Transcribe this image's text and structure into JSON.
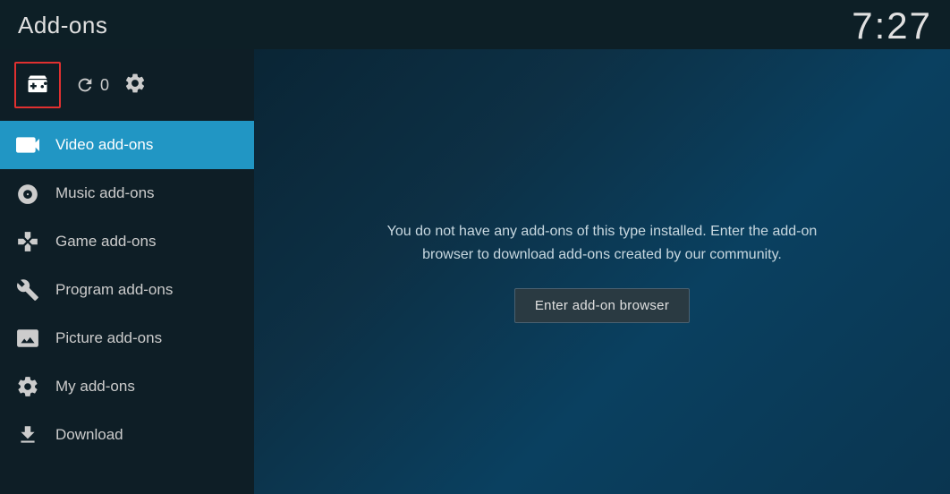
{
  "header": {
    "title": "Add-ons",
    "time": "7:27"
  },
  "toolbar": {
    "update_count": "0",
    "addon_box_icon": "addon-box-icon",
    "refresh_icon": "refresh-icon",
    "settings_icon": "gear-icon"
  },
  "sidebar": {
    "items": [
      {
        "id": "video",
        "label": "Video add-ons",
        "icon": "video-icon",
        "active": true
      },
      {
        "id": "music",
        "label": "Music add-ons",
        "icon": "music-icon",
        "active": false
      },
      {
        "id": "game",
        "label": "Game add-ons",
        "icon": "game-icon",
        "active": false
      },
      {
        "id": "program",
        "label": "Program add-ons",
        "icon": "program-icon",
        "active": false
      },
      {
        "id": "picture",
        "label": "Picture add-ons",
        "icon": "picture-icon",
        "active": false
      },
      {
        "id": "myaddon",
        "label": "My add-ons",
        "icon": "myaddon-icon",
        "active": false
      },
      {
        "id": "download",
        "label": "Download",
        "icon": "download-icon",
        "active": false
      }
    ]
  },
  "content": {
    "empty_message": "You do not have any add-ons of this type installed. Enter the add-on browser to download add-ons created by our community.",
    "browse_button_label": "Enter add-on browser"
  }
}
